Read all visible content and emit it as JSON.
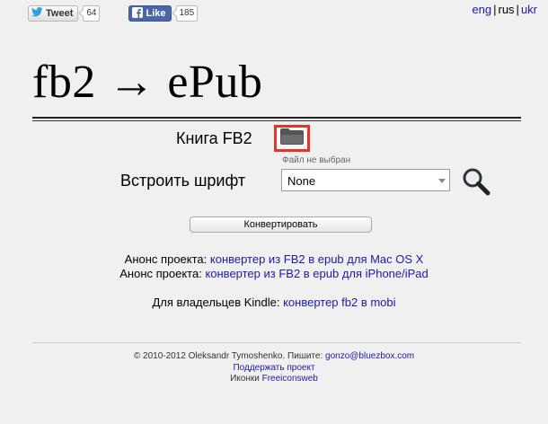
{
  "social": {
    "tweet_label": "Tweet",
    "tweet_count": "64",
    "like_label": "Like",
    "like_count": "185"
  },
  "languages": [
    "eng",
    "rus",
    "ukr"
  ],
  "title": "fb2 → ePub",
  "form": {
    "book_label": "Книга FB2",
    "no_file": "Файл не выбран",
    "font_label": "Встроить шрифт",
    "font_selected": "None",
    "convert_label": "Конвертировать"
  },
  "announcements": {
    "line1_prefix": "Анонс проекта: ",
    "line1_link": "конвертер из FB2 в epub для Mac OS X",
    "line2_prefix": "Анонс проекта: ",
    "line2_link": "конвертер из FB2 в epub для iPhone/iPad",
    "kindle_prefix": "Для владельцев Kindle: ",
    "kindle_link": "конвертер fb2 в mobi"
  },
  "footer": {
    "copyright": "© 2010-2012 Oleksandr Tymoshenko. Пишите: ",
    "email": "gonzo@bluezbox.com",
    "support": "Поддержать проект",
    "icons_prefix": "Иконки ",
    "icons_link": "Freeiconsweb"
  },
  "colors": {
    "link": "#1a1aa6",
    "highlight": "#e53324",
    "facebook": "#4a66a8"
  }
}
